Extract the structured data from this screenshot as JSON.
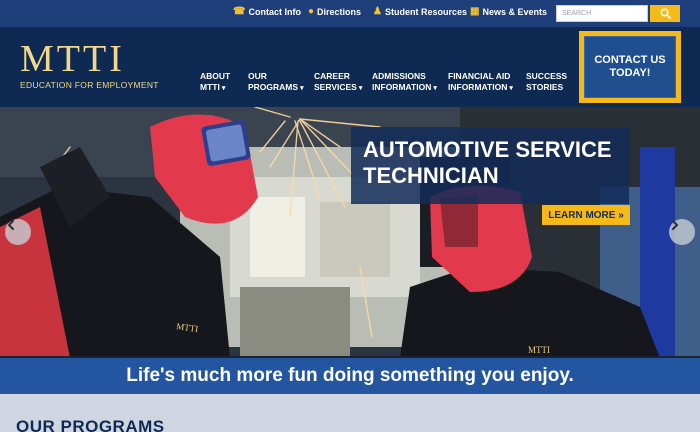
{
  "utility": {
    "links": [
      {
        "label": "Contact Info",
        "icon": "phone-icon"
      },
      {
        "label": "Directions",
        "icon": "map-pin-icon"
      },
      {
        "label": "Student Resources",
        "icon": "user-icon"
      },
      {
        "label": "News & Events",
        "icon": "calendar-icon"
      }
    ],
    "search_placeholder": "SEARCH",
    "search_value": ""
  },
  "logo": {
    "name": "MTTI",
    "tagline": "EDUCATION FOR EMPLOYMENT"
  },
  "nav": {
    "items": [
      {
        "line1": "ABOUT",
        "line2": "MTTI",
        "has_dropdown": true
      },
      {
        "line1": "OUR",
        "line2": "PROGRAMS",
        "has_dropdown": true
      },
      {
        "line1": "CAREER",
        "line2": "SERVICES",
        "has_dropdown": true
      },
      {
        "line1": "ADMISSIONS",
        "line2": "INFORMATION",
        "has_dropdown": true
      },
      {
        "line1": "FINANCIAL AID",
        "line2": "INFORMATION",
        "has_dropdown": true
      },
      {
        "line1": "SUCCESS",
        "line2": "STORIES",
        "has_dropdown": false
      }
    ],
    "contact_line1": "CONTACT US",
    "contact_line2": "TODAY!"
  },
  "hero": {
    "title": "AUTOMOTIVE SERVICE TECHNICIAN",
    "cta": "LEARN MORE »",
    "shirt_logo": "MTTI"
  },
  "tagline": "Life's much more fun doing something you enjoy.",
  "programs": {
    "heading": "OUR PROGRAMS"
  },
  "colors": {
    "navy": "#0f2a52",
    "utility_blue": "#1f3f7a",
    "gold": "#f5b91a",
    "accent_blue": "#2355a0",
    "welding_mask": "#e23a4c"
  }
}
